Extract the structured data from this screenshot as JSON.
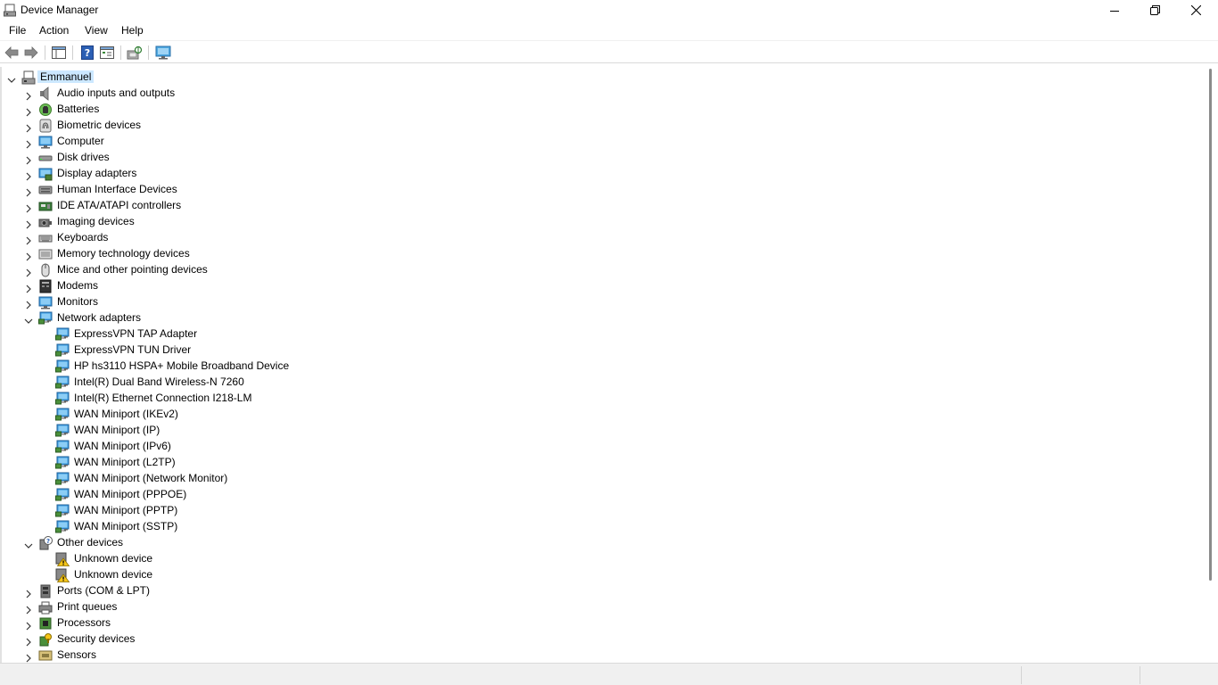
{
  "window": {
    "title": "Device Manager"
  },
  "menu": [
    "File",
    "Action",
    "View",
    "Help"
  ],
  "tree": {
    "root": "Emmanuel",
    "items": [
      {
        "label": "Audio inputs and outputs",
        "icon": "speaker-icon",
        "level": 1,
        "expanded": false
      },
      {
        "label": "Batteries",
        "icon": "battery-icon",
        "level": 1,
        "expanded": false
      },
      {
        "label": "Biometric devices",
        "icon": "fingerprint-icon",
        "level": 1,
        "expanded": false
      },
      {
        "label": "Computer",
        "icon": "computer-icon",
        "level": 1,
        "expanded": false
      },
      {
        "label": "Disk drives",
        "icon": "disk-drive-icon",
        "level": 1,
        "expanded": false
      },
      {
        "label": "Display adapters",
        "icon": "display-adapter-icon",
        "level": 1,
        "expanded": false
      },
      {
        "label": "Human Interface Devices",
        "icon": "hid-icon",
        "level": 1,
        "expanded": false
      },
      {
        "label": "IDE ATA/ATAPI controllers",
        "icon": "ide-controller-icon",
        "level": 1,
        "expanded": false
      },
      {
        "label": "Imaging devices",
        "icon": "camera-icon",
        "level": 1,
        "expanded": false
      },
      {
        "label": "Keyboards",
        "icon": "keyboard-icon",
        "level": 1,
        "expanded": false
      },
      {
        "label": "Memory technology devices",
        "icon": "memory-icon",
        "level": 1,
        "expanded": false
      },
      {
        "label": "Mice and other pointing devices",
        "icon": "mouse-icon",
        "level": 1,
        "expanded": false
      },
      {
        "label": "Modems",
        "icon": "modem-icon",
        "level": 1,
        "expanded": false
      },
      {
        "label": "Monitors",
        "icon": "monitor-icon",
        "level": 1,
        "expanded": false
      },
      {
        "label": "Network adapters",
        "icon": "network-adapter-icon",
        "level": 1,
        "expanded": true
      },
      {
        "label": "ExpressVPN TAP Adapter",
        "icon": "network-adapter-icon",
        "level": 2
      },
      {
        "label": "ExpressVPN TUN Driver",
        "icon": "network-adapter-icon",
        "level": 2
      },
      {
        "label": "HP hs3110 HSPA+ Mobile Broadband Device",
        "icon": "network-adapter-icon",
        "level": 2
      },
      {
        "label": "Intel(R) Dual Band Wireless-N 7260",
        "icon": "network-adapter-icon",
        "level": 2
      },
      {
        "label": "Intel(R) Ethernet Connection I218-LM",
        "icon": "network-adapter-icon",
        "level": 2
      },
      {
        "label": "WAN Miniport (IKEv2)",
        "icon": "network-adapter-icon",
        "level": 2
      },
      {
        "label": "WAN Miniport (IP)",
        "icon": "network-adapter-icon",
        "level": 2
      },
      {
        "label": "WAN Miniport (IPv6)",
        "icon": "network-adapter-icon",
        "level": 2
      },
      {
        "label": "WAN Miniport (L2TP)",
        "icon": "network-adapter-icon",
        "level": 2
      },
      {
        "label": "WAN Miniport (Network Monitor)",
        "icon": "network-adapter-icon",
        "level": 2
      },
      {
        "label": "WAN Miniport (PPPOE)",
        "icon": "network-adapter-icon",
        "level": 2
      },
      {
        "label": "WAN Miniport (PPTP)",
        "icon": "network-adapter-icon",
        "level": 2
      },
      {
        "label": "WAN Miniport (SSTP)",
        "icon": "network-adapter-icon",
        "level": 2
      },
      {
        "label": "Other devices",
        "icon": "other-devices-icon",
        "level": 1,
        "expanded": true
      },
      {
        "label": "Unknown device",
        "icon": "warning-device-icon",
        "level": 2
      },
      {
        "label": "Unknown device",
        "icon": "warning-device-icon",
        "level": 2
      },
      {
        "label": "Ports (COM & LPT)",
        "icon": "port-icon",
        "level": 1,
        "expanded": false
      },
      {
        "label": "Print queues",
        "icon": "printer-icon",
        "level": 1,
        "expanded": false
      },
      {
        "label": "Processors",
        "icon": "processor-icon",
        "level": 1,
        "expanded": false
      },
      {
        "label": "Security devices",
        "icon": "security-device-icon",
        "level": 1,
        "expanded": false
      },
      {
        "label": "Sensors",
        "icon": "sensor-icon",
        "level": 1,
        "expanded": false
      }
    ]
  },
  "colors": {
    "selection": "#cce8ff",
    "accent": "#1e90d6",
    "warning": "#f5c518"
  }
}
